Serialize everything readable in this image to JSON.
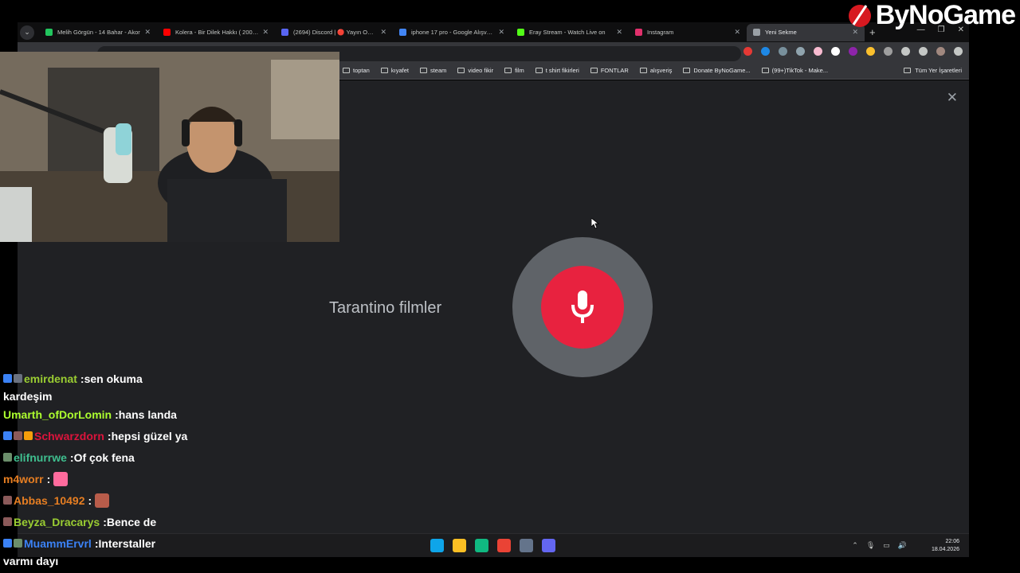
{
  "browser": {
    "tabs": [
      {
        "title": "Melih Görgün - 14 Bahar - Akor",
        "color": "#22c55e"
      },
      {
        "title": "Kolera - Bir Dilek Hakkı ( 2008 )",
        "color": "#ff0000"
      },
      {
        "title": "(2694) Discord | 🔴 Yayın Odası",
        "color": "#5865f2"
      },
      {
        "title": "iphone 17 pro - Google Alışveriş",
        "color": "#4285f4"
      },
      {
        "title": "Eray Stream - Watch Live on",
        "color": "#53fc18"
      },
      {
        "title": "Instagram",
        "color": "#e1306c"
      },
      {
        "title": "Yeni Sekme",
        "color": "#9aa0a6"
      }
    ],
    "active_tab_index": 6,
    "bookmarks": [
      "toptan",
      "kıyafet",
      "steam",
      "video fikir",
      "film",
      "t shirt fikirleri",
      "FONTLAR",
      "alışveriş",
      "Donate ByNoGame...",
      "(99+)TikTok - Make..."
    ],
    "all_bookmarks_label": "Tüm Yer İşaretleri",
    "extensions": [
      {
        "name": "adblock-icon",
        "color": "#e53935"
      },
      {
        "name": "extension-blue-icon",
        "color": "#1e88e5"
      },
      {
        "name": "printer-icon",
        "color": "#78909c"
      },
      {
        "name": "dash-icon",
        "color": "#90a4ae"
      },
      {
        "name": "extension-pink-icon",
        "color": "#f8bbd0"
      },
      {
        "name": "extension-diamond-icon",
        "color": "#ffffff"
      },
      {
        "name": "extension-purple-icon",
        "color": "#8e24aa"
      },
      {
        "name": "extension-yellow-icon",
        "color": "#fbc02d"
      },
      {
        "name": "extension-grey-icon",
        "color": "#9e9e9e"
      },
      {
        "name": "puzzle-icon",
        "color": "#c4c7c5"
      },
      {
        "name": "reading-list-icon",
        "color": "#c4c7c5"
      },
      {
        "name": "profile-avatar-icon",
        "color": "#a1887f"
      },
      {
        "name": "menu-dots-icon",
        "color": "#c4c7c5"
      }
    ]
  },
  "voice_search": {
    "transcript": "Tarantino filmler",
    "mic_color": "#e8223f",
    "ring_color": "#5f6368"
  },
  "chat": [
    {
      "user": "emirdenat",
      "color": "#9acd32",
      "message": "sen okuma",
      "cont": "kardeşim",
      "badges": [
        "#3b82f6",
        "#6b7280"
      ]
    },
    {
      "user": "Umarth_ofDorLomin",
      "color": "#adff2f",
      "message": "hans landa",
      "badges": []
    },
    {
      "user": "Schwarzdorn",
      "color": "#dc143c",
      "message": "hepsi güzel ya",
      "badges": [
        "#3b82f6",
        "#8b5a5a",
        "#f59e0b"
      ]
    },
    {
      "user": "elifnurrwe",
      "color": "#3fbf8f",
      "message": "Of çok fena",
      "badges": [
        "#6b8e6b"
      ]
    },
    {
      "user": "m4worr",
      "color": "#e67e22",
      "message": "",
      "emote": "#ff6b9d",
      "badges": []
    },
    {
      "user": "Abbas_10492",
      "color": "#e67e22",
      "message": "",
      "emote": "#b85c4a",
      "badges": [
        "#8b5a5a"
      ]
    },
    {
      "user": "Beyza_Dracarys",
      "color": "#9acd32",
      "message": "Bence de",
      "badges": [
        "#8b5a5a"
      ]
    },
    {
      "user": "MuammErvrl",
      "color": "#3b82f6",
      "message": "Interstaller",
      "cont": "varmı dayı",
      "badges": [
        "#3b82f6",
        "#6b8e6b"
      ]
    }
  ],
  "taskbar": {
    "apps": [
      {
        "name": "windows-start-icon",
        "color": "#0ea5e9"
      },
      {
        "name": "file-explorer-icon",
        "color": "#fbbf24"
      },
      {
        "name": "terminal-icon",
        "color": "#10b981"
      },
      {
        "name": "chrome-icon",
        "color": "#ea4335"
      },
      {
        "name": "steam-icon",
        "color": "#64748b"
      },
      {
        "name": "cortana-icon",
        "color": "#6366f1"
      }
    ],
    "time": "22:06",
    "date": "18.04.2026"
  },
  "brand": {
    "name": "ByNoGame"
  }
}
